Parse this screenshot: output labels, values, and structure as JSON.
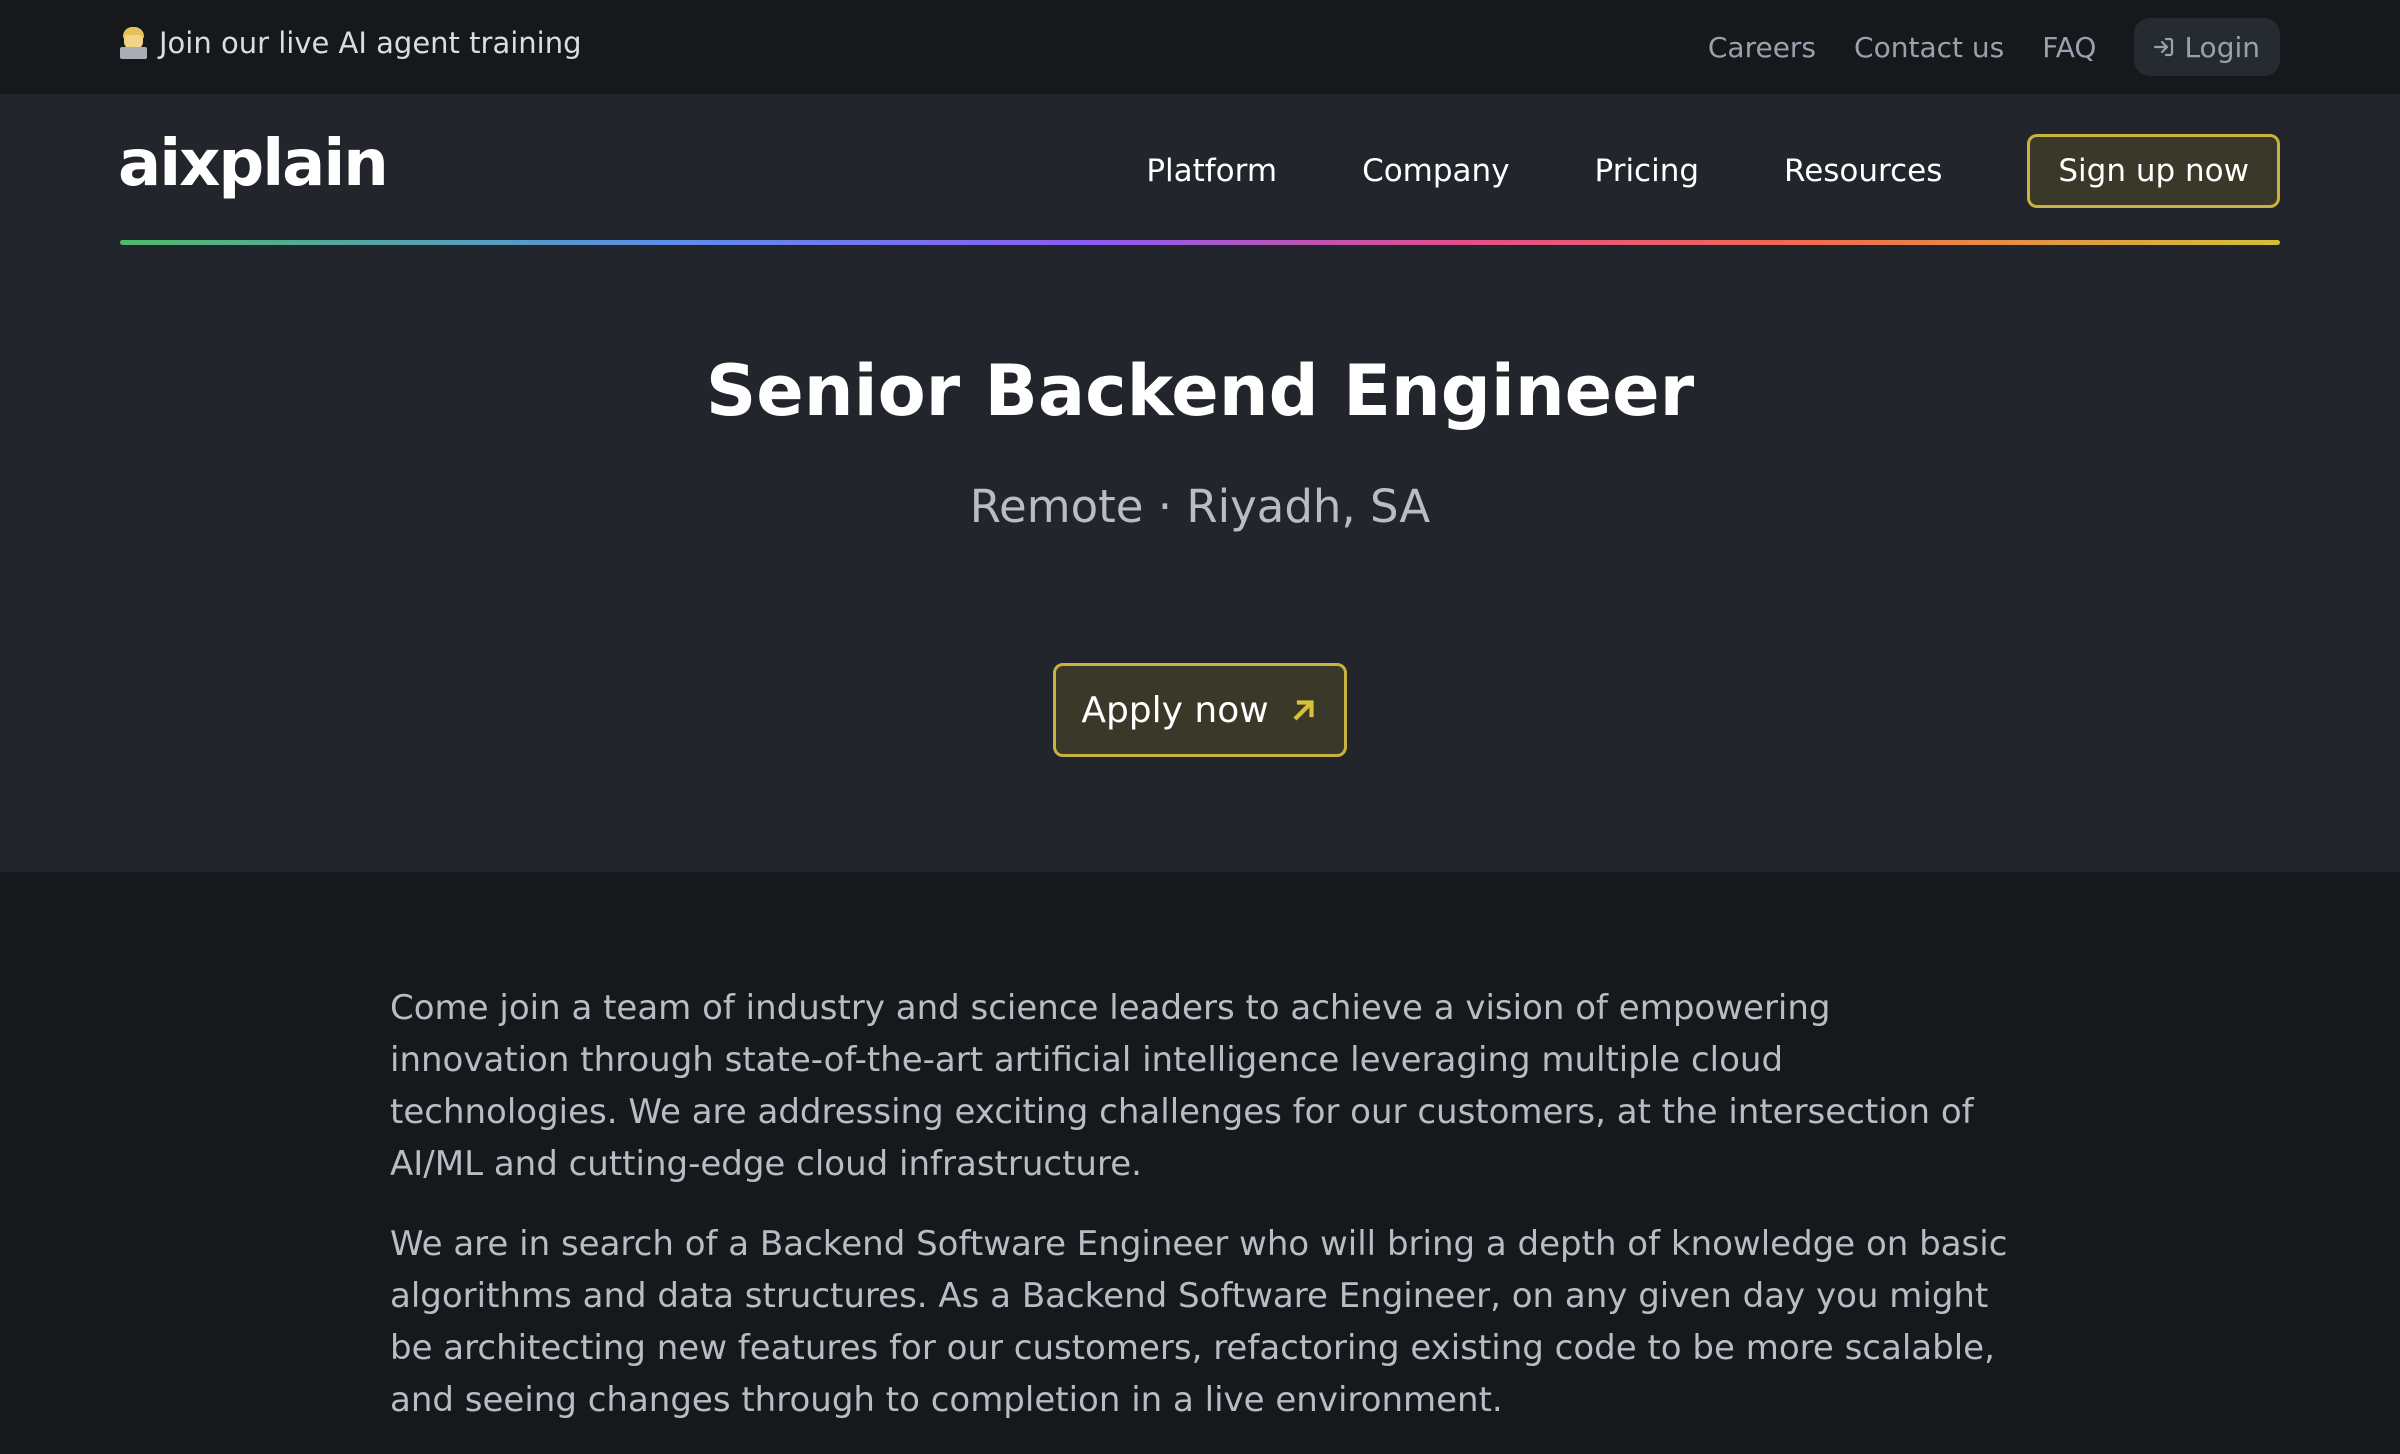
{
  "topbar": {
    "announcement": "Join our live AI agent training",
    "announcement_icon": "technologist-emoji-icon",
    "links": [
      "Careers",
      "Contact us",
      "FAQ"
    ],
    "login_label": "Login"
  },
  "header": {
    "logo_text": "aixplain",
    "nav": [
      "Platform",
      "Company",
      "Pricing",
      "Resources"
    ],
    "signup_label": "Sign up now"
  },
  "job": {
    "title": "Senior Backend Engineer",
    "location": "Remote · Riyadh, SA",
    "apply_label": "Apply now"
  },
  "description": {
    "paragraphs": [
      "Come join a team of industry and science leaders to achieve a vision of empowering innovation through state-of-the-art artificial intelligence leveraging multiple cloud technologies. We are addressing exciting challenges for our customers, at the intersection of AI/ML and cutting-edge cloud infrastructure.",
      "We are in search of a Backend Software Engineer who will bring a depth of knowledge on basic algorithms and data structures. As a Backend Software Engineer, on any given day you might be architecting new features for our customers, refactoring existing code to be more scalable, and seeing changes through to completion in a live environment."
    ]
  },
  "colors": {
    "page_bg": "#16181c",
    "hero_bg": "#22252b",
    "accent_border": "#c9b23f",
    "accent_fill": "#3a3828",
    "muted_text": "#9aa1ad"
  }
}
